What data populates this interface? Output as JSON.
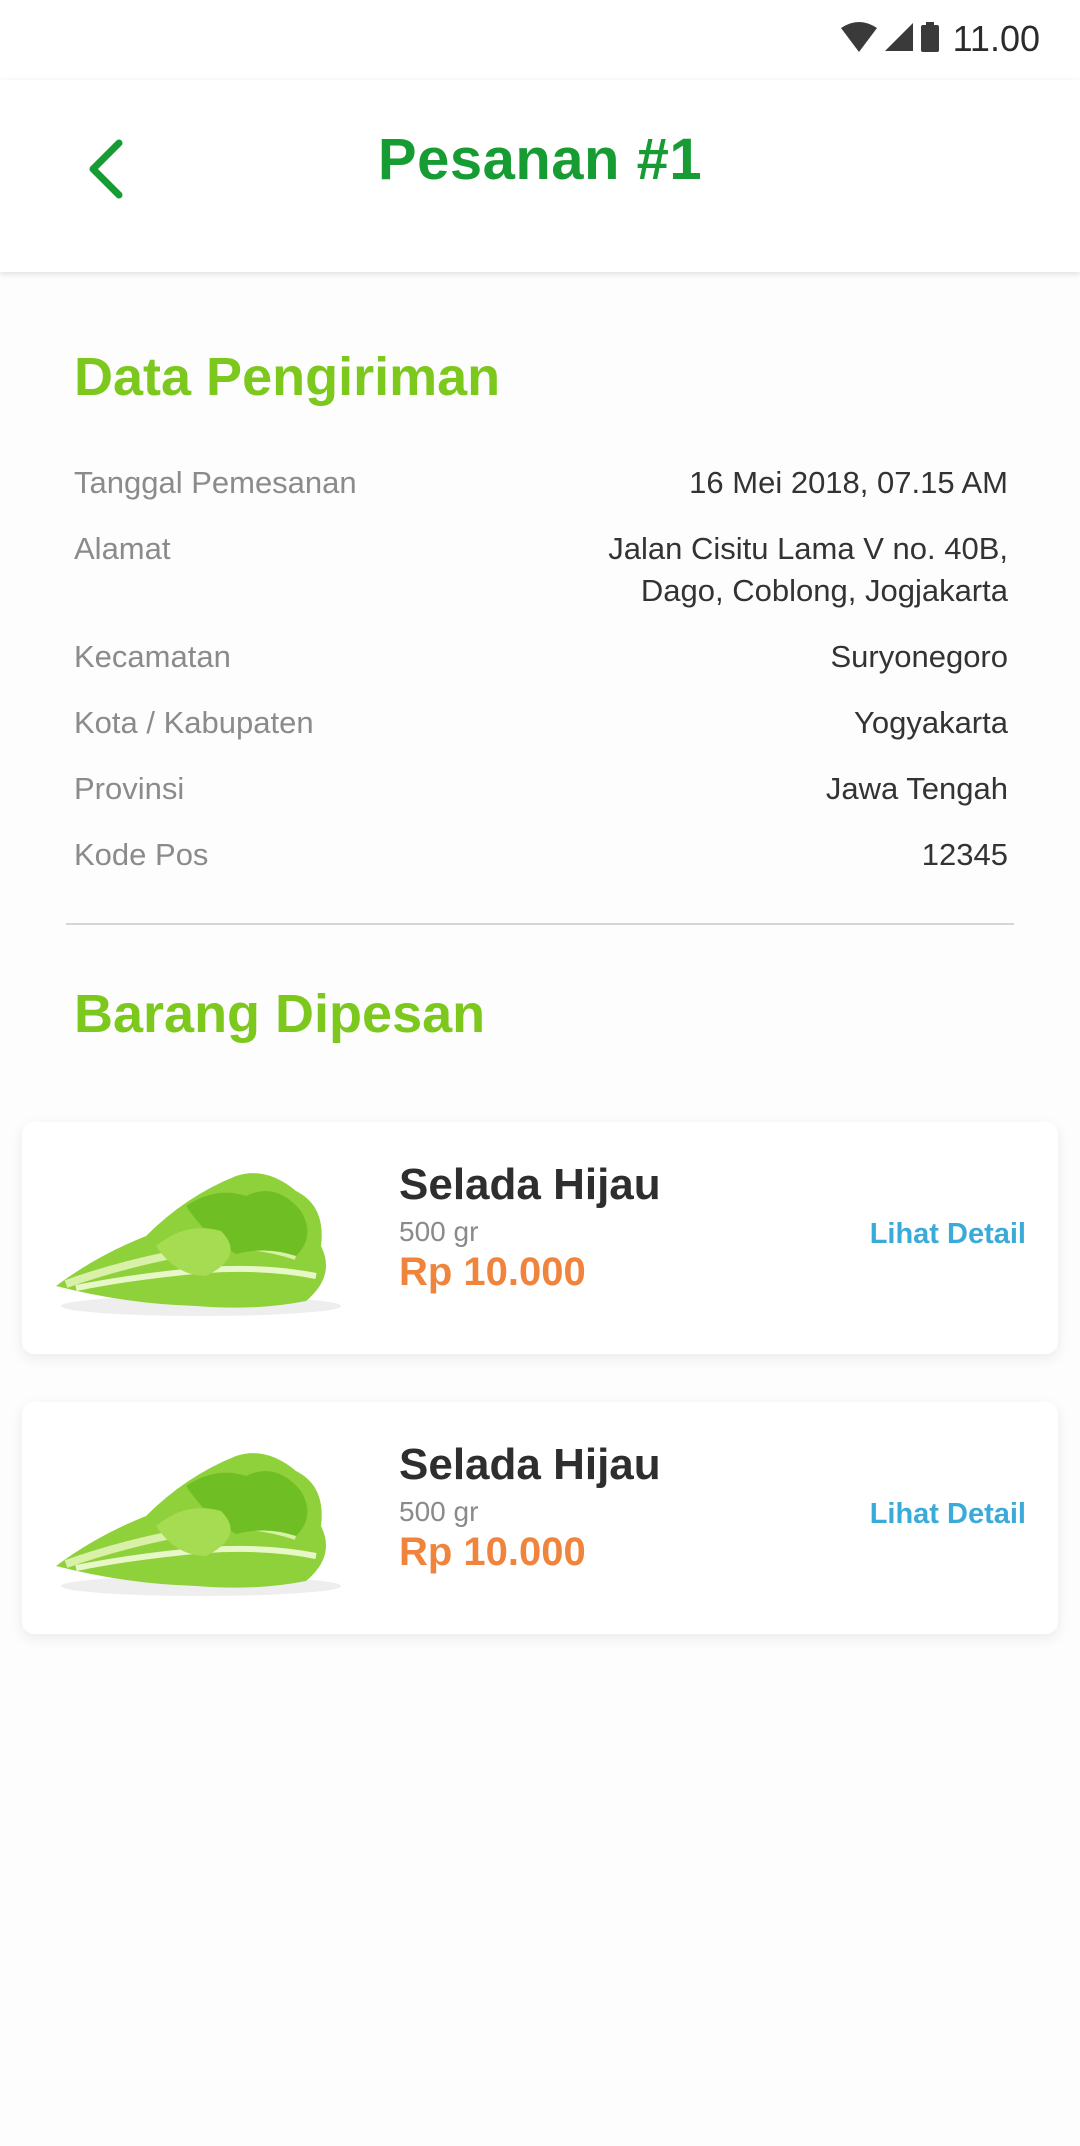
{
  "status_bar": {
    "time": "11.00",
    "icons": [
      "wifi-icon",
      "signal-icon",
      "battery-icon"
    ]
  },
  "header": {
    "title": "Pesanan #1",
    "back_icon": "chevron-left-icon"
  },
  "shipping": {
    "title": "Data Pengiriman",
    "rows": [
      {
        "label": "Tanggal Pemesanan",
        "value": "16 Mei 2018, 07.15 AM"
      },
      {
        "label": "Alamat",
        "value": "Jalan Cisitu Lama V no. 40B,\nDago, Coblong, Jogjakarta"
      },
      {
        "label": "Kecamatan",
        "value": "Suryonegoro"
      },
      {
        "label": "Kota / Kabupaten",
        "value": "Yogyakarta"
      },
      {
        "label": "Provinsi",
        "value": "Jawa Tengah"
      },
      {
        "label": "Kode Pos",
        "value": "12345"
      }
    ]
  },
  "ordered_items": {
    "title": "Barang Dipesan",
    "items": [
      {
        "name": "Selada Hijau",
        "weight": "500 gr",
        "price": "Rp 10.000",
        "link": "Lihat Detail"
      },
      {
        "name": "Selada Hijau",
        "weight": "500 gr",
        "price": "Rp 10.000",
        "link": "Lihat Detail"
      }
    ]
  },
  "colors": {
    "title_green": "#179c34",
    "section_green": "#7cc81d",
    "price_orange": "#f0843c",
    "link_blue": "#3aaad9"
  }
}
